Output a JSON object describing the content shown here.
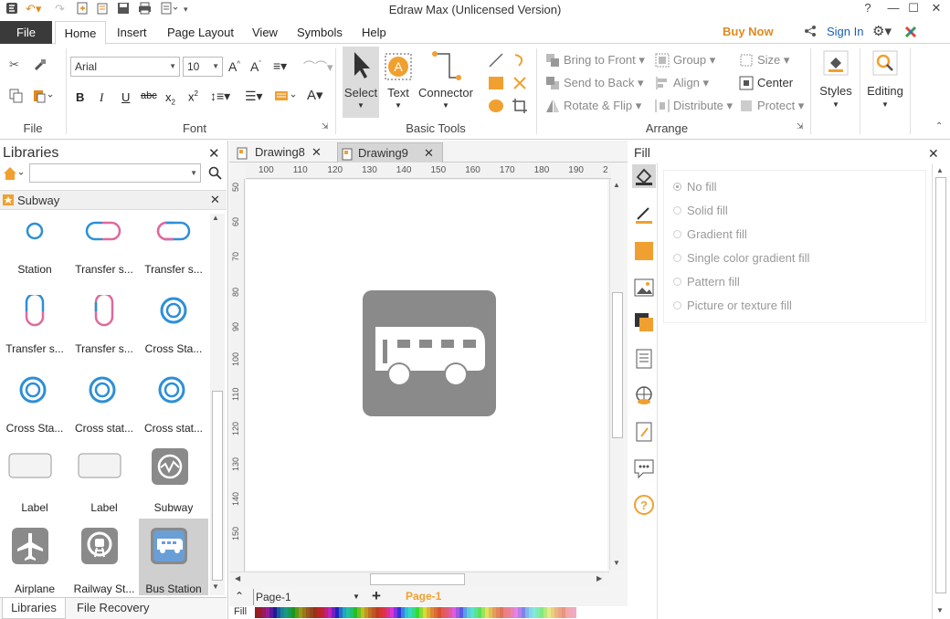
{
  "app": {
    "title": "Edraw Max (Unlicensed Version)"
  },
  "menu": {
    "file": "File",
    "tabs": [
      "Home",
      "Insert",
      "Page Layout",
      "View",
      "Symbols",
      "Help"
    ],
    "buy_now": "Buy Now",
    "sign_in": "Sign In"
  },
  "ribbon": {
    "font_name": "Arial",
    "font_size": "10",
    "groups": {
      "file": "File",
      "font": "Font",
      "basic_tools": "Basic Tools",
      "arrange": "Arrange"
    },
    "tools": {
      "select": "Select",
      "text": "Text",
      "connector": "Connector"
    },
    "arrange": {
      "bring_to_front": "Bring to Front",
      "send_to_back": "Send to Back",
      "rotate_flip": "Rotate & Flip",
      "group": "Group",
      "align": "Align",
      "distribute": "Distribute",
      "size": "Size",
      "center": "Center",
      "protect": "Protect"
    },
    "styles": "Styles",
    "editing": "Editing"
  },
  "libraries": {
    "title": "Libraries",
    "section": "Subway",
    "symbols": [
      {
        "label": "Station"
      },
      {
        "label": "Transfer s..."
      },
      {
        "label": "Transfer s..."
      },
      {
        "label": "Transfer s..."
      },
      {
        "label": "Transfer s..."
      },
      {
        "label": "Cross Sta..."
      },
      {
        "label": "Cross Sta..."
      },
      {
        "label": "Cross stat..."
      },
      {
        "label": "Cross stat..."
      },
      {
        "label": "Label"
      },
      {
        "label": "Label"
      },
      {
        "label": "Subway"
      },
      {
        "label": "Airplane"
      },
      {
        "label": "Railway St..."
      },
      {
        "label": "Bus Station"
      }
    ],
    "bottom_tabs": [
      "Libraries",
      "File Recovery"
    ]
  },
  "documents": {
    "tabs": [
      "Drawing8",
      "Drawing9"
    ],
    "ruler_h": [
      "100",
      "110",
      "120",
      "130",
      "140",
      "150",
      "160",
      "170",
      "180",
      "190",
      "2"
    ],
    "ruler_v": [
      "50",
      "60",
      "70",
      "80",
      "90",
      "100",
      "110",
      "120",
      "130",
      "140",
      "150"
    ],
    "page_select": "Page-1",
    "page_tab": "Page-1",
    "fill_label": "Fill"
  },
  "fill_panel": {
    "title": "Fill",
    "options": [
      "No fill",
      "Solid fill",
      "Gradient fill",
      "Single color gradient fill",
      "Pattern fill",
      "Picture or texture fill"
    ]
  },
  "colors": {
    "accent": "#f0a030",
    "blue_link": "#1a5fb4",
    "bus_gray": "#8a8a8a"
  }
}
